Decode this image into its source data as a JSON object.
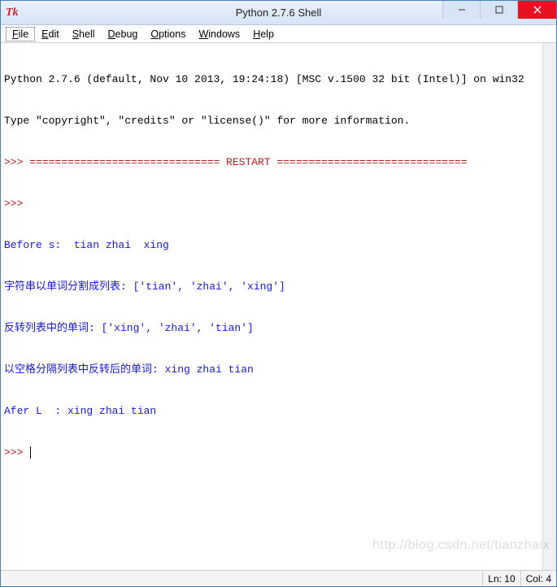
{
  "window": {
    "title": "Python 2.7.6 Shell",
    "icon_text": "Tk"
  },
  "menu": {
    "items": [
      {
        "label": "File",
        "uchar": "F",
        "rest": "ile",
        "active": true
      },
      {
        "label": "Edit",
        "uchar": "E",
        "rest": "dit"
      },
      {
        "label": "Shell",
        "uchar": "S",
        "rest": "hell"
      },
      {
        "label": "Debug",
        "uchar": "D",
        "rest": "ebug"
      },
      {
        "label": "Options",
        "uchar": "O",
        "rest": "ptions"
      },
      {
        "label": "Windows",
        "uchar": "W",
        "rest": "indows"
      },
      {
        "label": "Help",
        "uchar": "H",
        "rest": "elp"
      }
    ]
  },
  "shell": {
    "banner1": "Python 2.7.6 (default, Nov 10 2013, 19:24:18) [MSC v.1500 32 bit (Intel)] on win32",
    "banner2": "Type \"copyright\", \"credits\" or \"license()\" for more information.",
    "restart_line": ">>> ============================== RESTART ==============================",
    "prompt": ">>> ",
    "lines": [
      "Before s:  tian zhai  xing",
      "字符串以单词分割成列表: ['tian', 'zhai', 'xing']",
      "反转列表中的单词: ['xing', 'zhai', 'tian']",
      "以空格分隔列表中反转后的单词: xing zhai tian",
      "Afer L  : xing zhai tian"
    ]
  },
  "status": {
    "line": "Ln: 10",
    "col": "Col: 4"
  },
  "watermark": "http://blog.csdn.net/tianzhaix"
}
